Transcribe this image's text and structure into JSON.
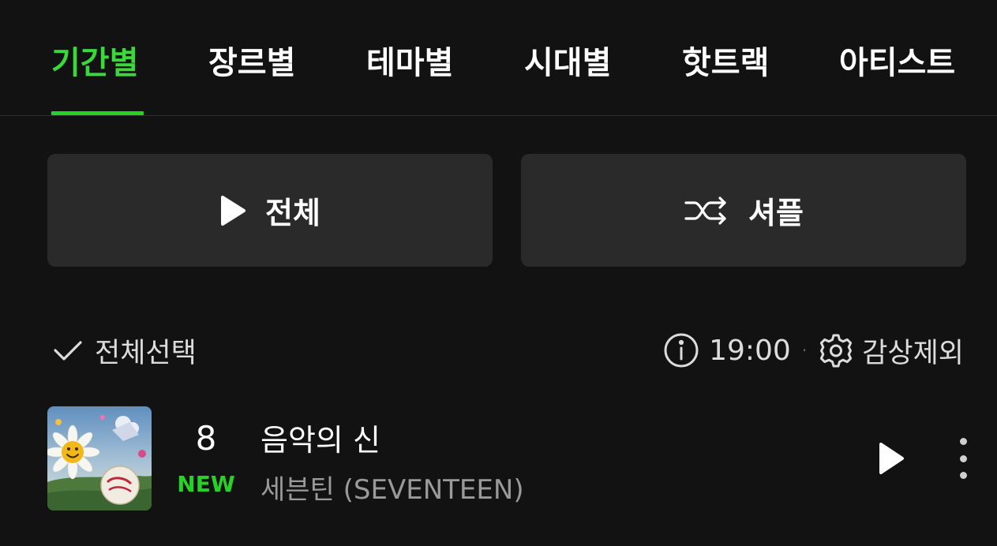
{
  "tabs": [
    {
      "label": "기간별",
      "active": true
    },
    {
      "label": "장르별",
      "active": false
    },
    {
      "label": "테마별",
      "active": false
    },
    {
      "label": "시대별",
      "active": false
    },
    {
      "label": "핫트랙",
      "active": false
    },
    {
      "label": "아티스트",
      "active": false
    }
  ],
  "actions": {
    "play_all_label": "전체",
    "play_all_icon": "play-icon",
    "shuffle_label": "셔플",
    "shuffle_icon": "shuffle-icon"
  },
  "list_header": {
    "select_all_label": "전체선택",
    "select_icon": "check-icon",
    "update_time": "19:00",
    "info_icon": "info-icon",
    "separator": "·",
    "exclude_label": "감상제외",
    "settings_icon": "gear-icon"
  },
  "tracks": [
    {
      "rank": "8",
      "rank_status": "NEW",
      "title": "음악의 신",
      "artist": "세븐틴 (SEVENTEEN)"
    }
  ],
  "colors": {
    "accent": "#27d227",
    "background": "#121212",
    "button_bg": "#2a2a2a",
    "secondary_text": "#9a9a9a"
  }
}
